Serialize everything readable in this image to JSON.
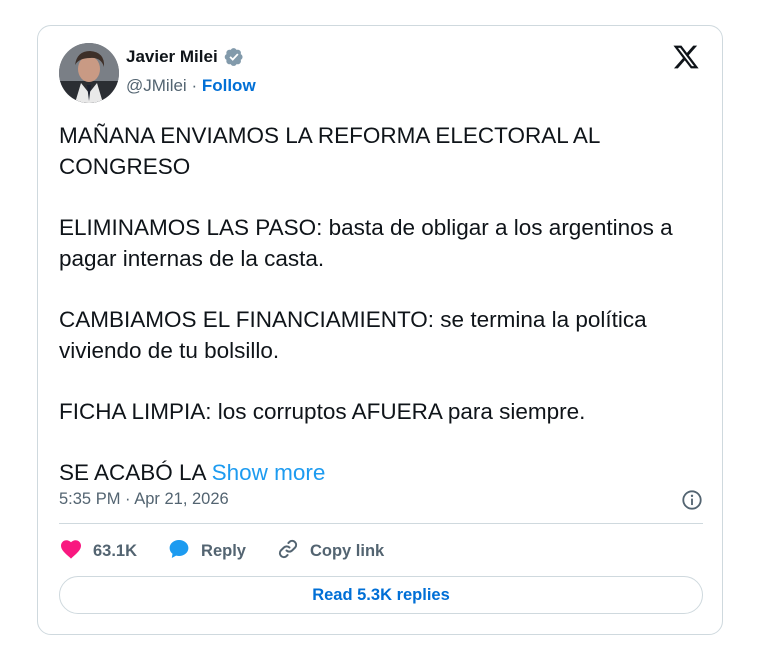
{
  "tweet": {
    "author": {
      "name": "Javier Milei",
      "handle": "@JMilei",
      "separator": "·",
      "follow_label": "Follow",
      "verified_icon": "verified-badge-icon"
    },
    "platform_icon": "x-logo-icon",
    "paragraphs": [
      "MAÑANA ENVIAMOS LA REFORMA ELECTORAL AL CONGRESO",
      "ELIMINAMOS LAS PASO: basta de obligar a los argentinos a pagar internas de la casta.",
      "CAMBIAMOS EL FINANCIAMIENTO: se termina la política viviendo de tu bolsillo.",
      "FICHA LIMPIA: los corruptos AFUERA para siempre."
    ],
    "last_line": "SE ACABÓ LA",
    "show_more_label": "Show more",
    "timestamp": "5:35 PM · Apr 21, 2026",
    "actions": {
      "likes": "63.1K",
      "reply_label": "Reply",
      "copy_link_label": "Copy link"
    },
    "read_replies_label": "Read 5.3K replies",
    "colors": {
      "link_blue": "#006fd6",
      "show_more_blue": "#1d9bf0",
      "heart": "#f91880",
      "reply_bubble": "#1d9bf0",
      "text_primary": "#0f1419",
      "text_secondary": "#536471",
      "border": "#cfd9de"
    }
  }
}
